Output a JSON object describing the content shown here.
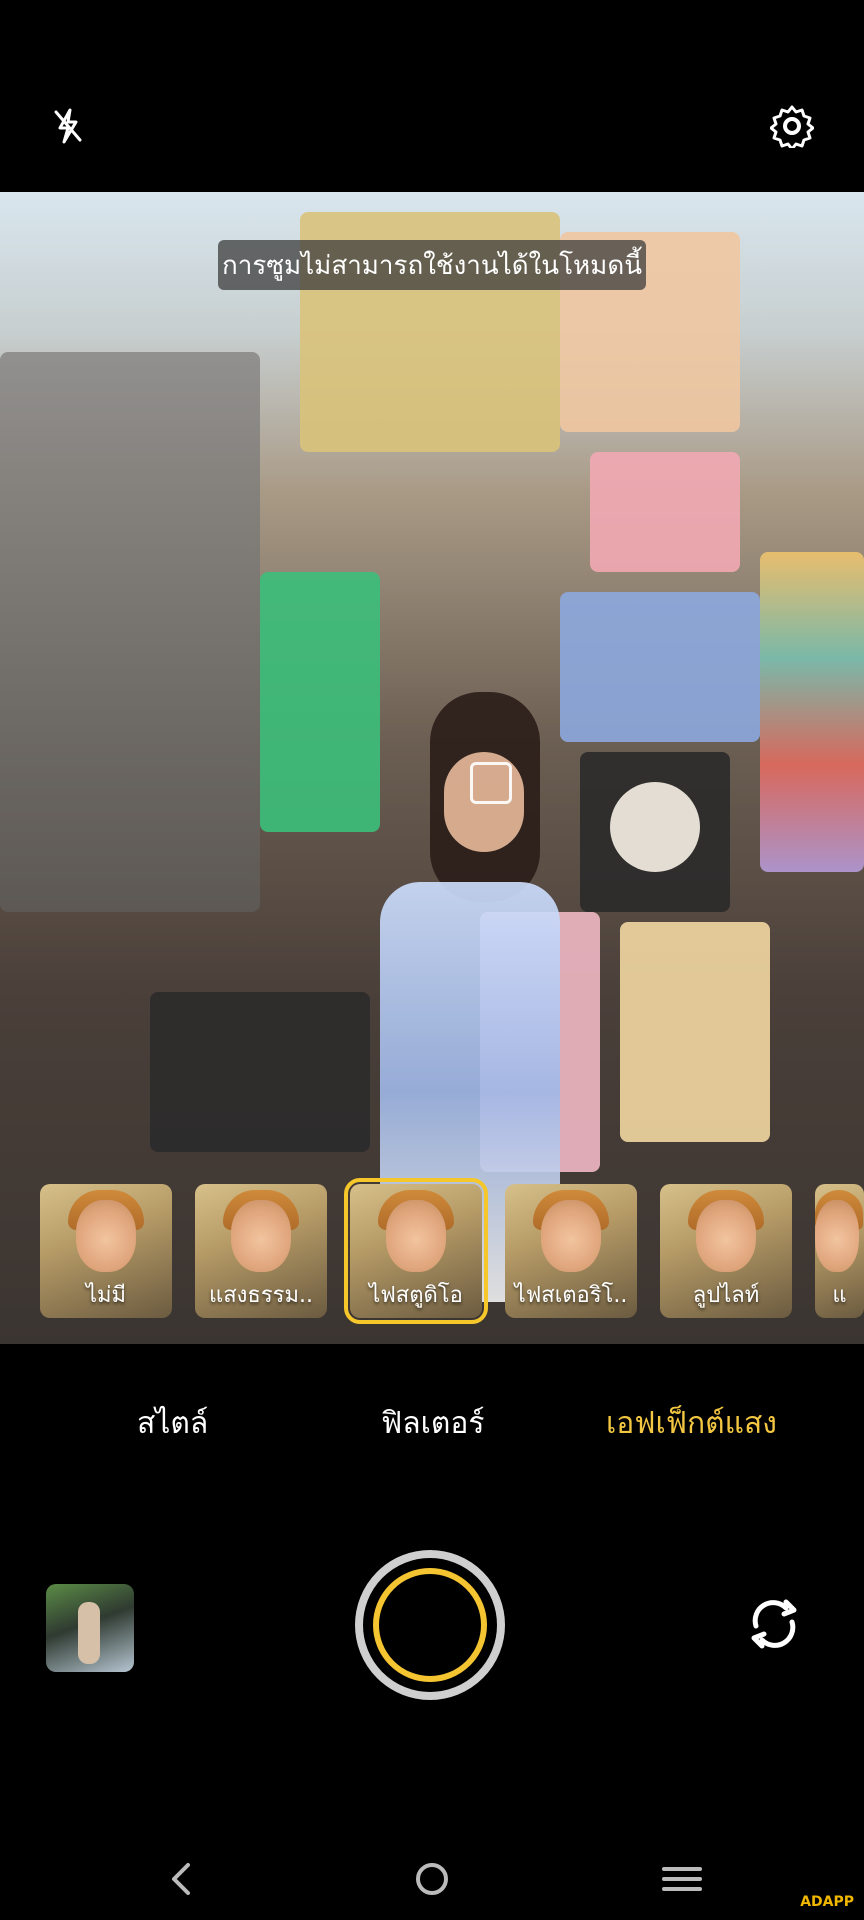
{
  "top_bar": {
    "flash_icon": "flash-off-icon",
    "settings_icon": "gear-icon"
  },
  "viewfinder": {
    "toast": "การซูมไม่สามารถใช้งานได้ในโหมดนี้"
  },
  "effects": [
    {
      "label": "ไม่มี",
      "selected": false
    },
    {
      "label": "แสงธรรม..",
      "selected": false
    },
    {
      "label": "ไฟสตูดิโอ",
      "selected": true
    },
    {
      "label": "ไฟสเตอริโ..",
      "selected": false
    },
    {
      "label": "ลูปไลท์",
      "selected": false
    },
    {
      "label": "แ",
      "selected": false
    }
  ],
  "modes": {
    "style": "สไตล์",
    "filter": "ฟิลเตอร์",
    "light_effect": "เอฟเฟ็กต์แสง",
    "active": "light_effect"
  },
  "bottom_controls": {
    "gallery_icon": "gallery-thumbnail",
    "shutter_icon": "shutter-button",
    "switch_icon": "switch-camera-icon"
  },
  "nav": {
    "back_icon": "back-icon",
    "home_icon": "home-icon",
    "menu_icon": "menu-icon"
  },
  "watermark": "ADAPP",
  "colors": {
    "accent": "#f3c741",
    "background": "#000000"
  }
}
